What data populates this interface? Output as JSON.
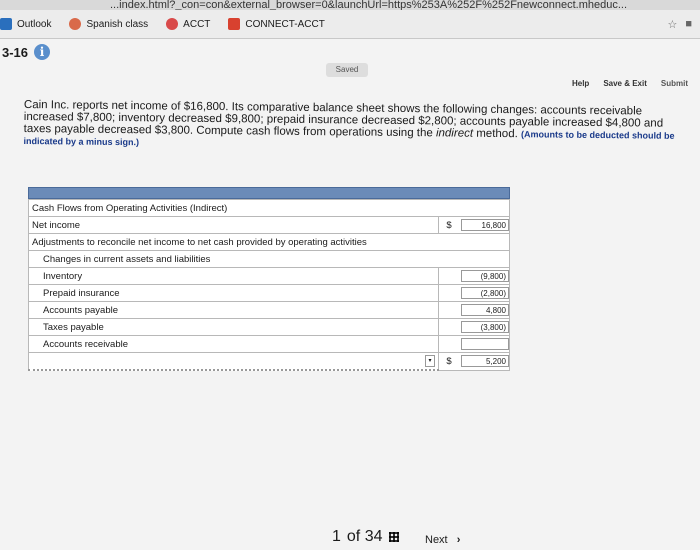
{
  "browser": {
    "url": "...index.html?_con=con&external_browser=0&launchUrl=https%253A%252F%252Fnewconnect.mheduc..."
  },
  "bookmarks": [
    {
      "label": "Outlook",
      "icon": "outlook-icon",
      "color": "#2a6fbd"
    },
    {
      "label": "Spanish class",
      "icon": "spanish-class-icon",
      "color": "#d96a4a"
    },
    {
      "label": "ACCT",
      "icon": "acct-icon",
      "color": "#d94a4a"
    },
    {
      "label": "CONNECT-ACCT",
      "icon": "connect-acct-icon",
      "color": "#d8412f"
    }
  ],
  "question": {
    "number": "3-16",
    "status": "Saved",
    "links": {
      "help": "Help",
      "save_exit": "Save & Exit",
      "submit": "Submit"
    },
    "text": "Cain Inc. reports net income of $16,800. Its comparative balance sheet shows the following changes: accounts receivable increased $7,800; inventory decreased $9,800; prepaid insurance decreased $2,800; accounts payable increased $4,800 and taxes payable decreased $3,800. Compute cash flows from operations using the ",
    "method": "indirect",
    "text_after": " method. ",
    "note": "(Amounts to be deducted should be indicated by a minus sign.)"
  },
  "table": {
    "title": "Cash Flows from Operating Activities (Indirect)",
    "net_income_label": "Net income",
    "net_income_currency": "$",
    "net_income_value": "16,800",
    "adjustments_label": "Adjustments to reconcile net income to net cash provided by operating activities",
    "changes_label": "Changes in current assets and liabilities",
    "rows": [
      {
        "label": "Inventory",
        "value": "(9,800)"
      },
      {
        "label": "Prepaid insurance",
        "value": "(2,800)"
      },
      {
        "label": "Accounts payable",
        "value": "4,800"
      },
      {
        "label": "Taxes payable",
        "value": "(3,800)"
      },
      {
        "label": "Accounts receivable",
        "value": ""
      }
    ],
    "total_currency": "$",
    "total_value": "5,200"
  },
  "pager": {
    "position": "1",
    "of": "of 34",
    "next": "Next"
  }
}
